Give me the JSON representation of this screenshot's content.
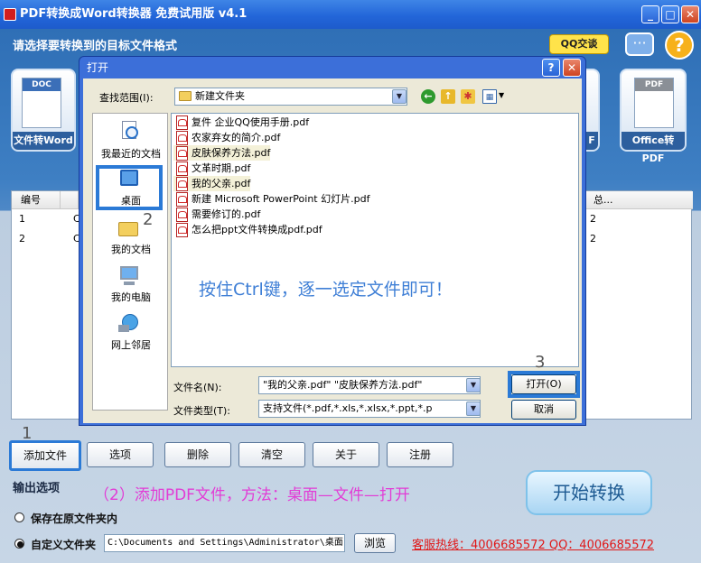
{
  "app": {
    "title": "PDF转换成Word转换器 免费试用版 v4.1",
    "subtitle": "请选择要转换到的目标文件格式",
    "qq": "QQ交谈",
    "help": "?",
    "window_controls": {
      "minimize": "_",
      "maximize": "□",
      "close": "✕"
    }
  },
  "tiles": {
    "left": {
      "doc": "DOC",
      "label": "文件转Word"
    },
    "right": {
      "doc": "PDF",
      "label": "Office转PDF"
    },
    "partial": "F"
  },
  "table": {
    "headers": [
      "编号",
      "总..."
    ],
    "rows": [
      {
        "num": "1",
        "col2": "C",
        "total": "2"
      },
      {
        "num": "2",
        "col2": "C",
        "total": "2"
      }
    ]
  },
  "toolbar": {
    "add": "添加文件",
    "options": "选项",
    "delete": "删除",
    "clear": "清空",
    "about": "关于",
    "register": "注册"
  },
  "output": {
    "title": "输出选项",
    "save_original": "保存在原文件夹内",
    "custom_folder": "自定义文件夹",
    "path": "C:\\Documents and Settings\\Administrator\\桌面",
    "browse": "浏览"
  },
  "start": "开始转换",
  "hotline": "客服热线：4006685572 QQ：4006685572",
  "instruction": "（2）添加PDF文件，方法：桌面—文件—打开",
  "steps": {
    "one": "1",
    "two": "2",
    "three": "3"
  },
  "dialog": {
    "title": "打开",
    "help": "?",
    "close": "✕",
    "lookin_label": "查找范围(I):",
    "lookin_value": "新建文件夹",
    "places": [
      "我最近的文档",
      "桌面",
      "我的文档",
      "我的电脑",
      "网上邻居"
    ],
    "files": [
      "复件 企业QQ使用手册.pdf",
      "农家弃女的简介.pdf",
      "皮肤保养方法.pdf",
      "文革时期.pdf",
      "我的父亲.pdf",
      "新建 Microsoft PowerPoint 幻灯片.pdf",
      "需要修订的.pdf",
      "怎么把ppt文件转换成pdf.pdf"
    ],
    "hint": "按住Ctrl键，逐一选定文件即可！",
    "filename_label": "文件名(N):",
    "filename_value": "\"我的父亲.pdf\" \"皮肤保养方法.pdf\"",
    "filetype_label": "文件类型(T):",
    "filetype_value": "支持文件(*.pdf,*.xls,*.xlsx,*.ppt,*.p",
    "open": "打开(O)",
    "cancel": "取消"
  }
}
